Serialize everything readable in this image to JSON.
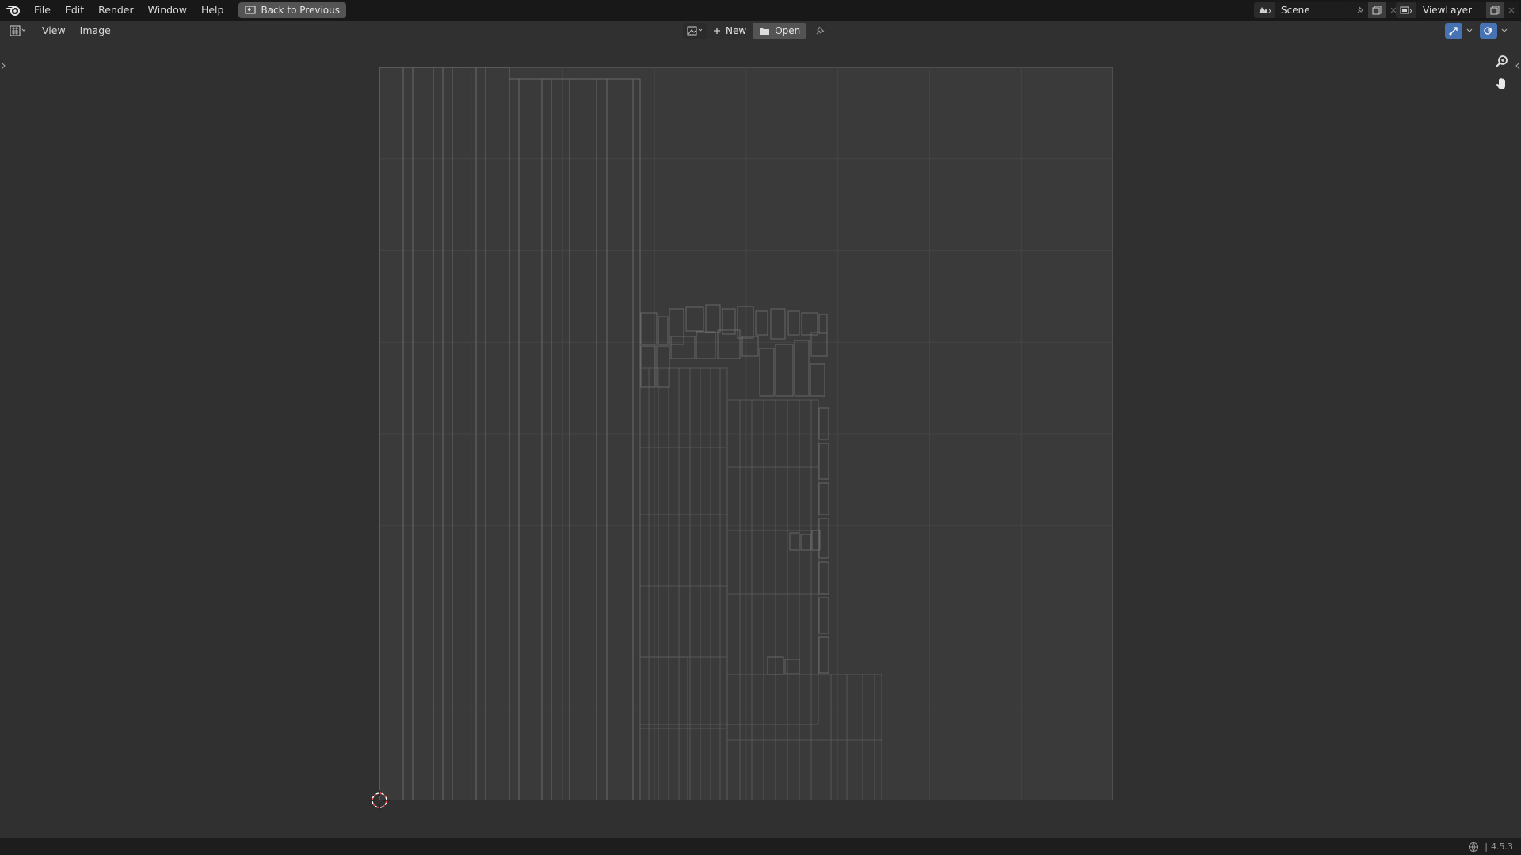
{
  "topbar": {
    "menus": [
      "File",
      "Edit",
      "Render",
      "Window",
      "Help"
    ],
    "back_button": "Back to Previous",
    "scene_name": "Scene",
    "view_layer_name": "ViewLayer"
  },
  "header": {
    "menus": [
      "View",
      "Image"
    ],
    "new_label": "New",
    "open_label": "Open"
  },
  "status": {
    "version": "4.5.3"
  },
  "colors": {
    "topbar_bg": "#181818",
    "editor_bg": "#303030",
    "uv_bg": "#3a3a3a",
    "accent_blue": "#4772b3"
  },
  "icons": [
    "blender-logo-icon",
    "back-icon",
    "editor-type-icon",
    "image-browse-icon",
    "plus-icon",
    "folder-icon",
    "pin-icon",
    "scene-icon",
    "new-scene-icon",
    "close-icon",
    "viewlayer-icon",
    "gizmo-icon",
    "overlay-icon",
    "zoom-icon",
    "hand-icon",
    "cursor-icon",
    "network-icon"
  ]
}
